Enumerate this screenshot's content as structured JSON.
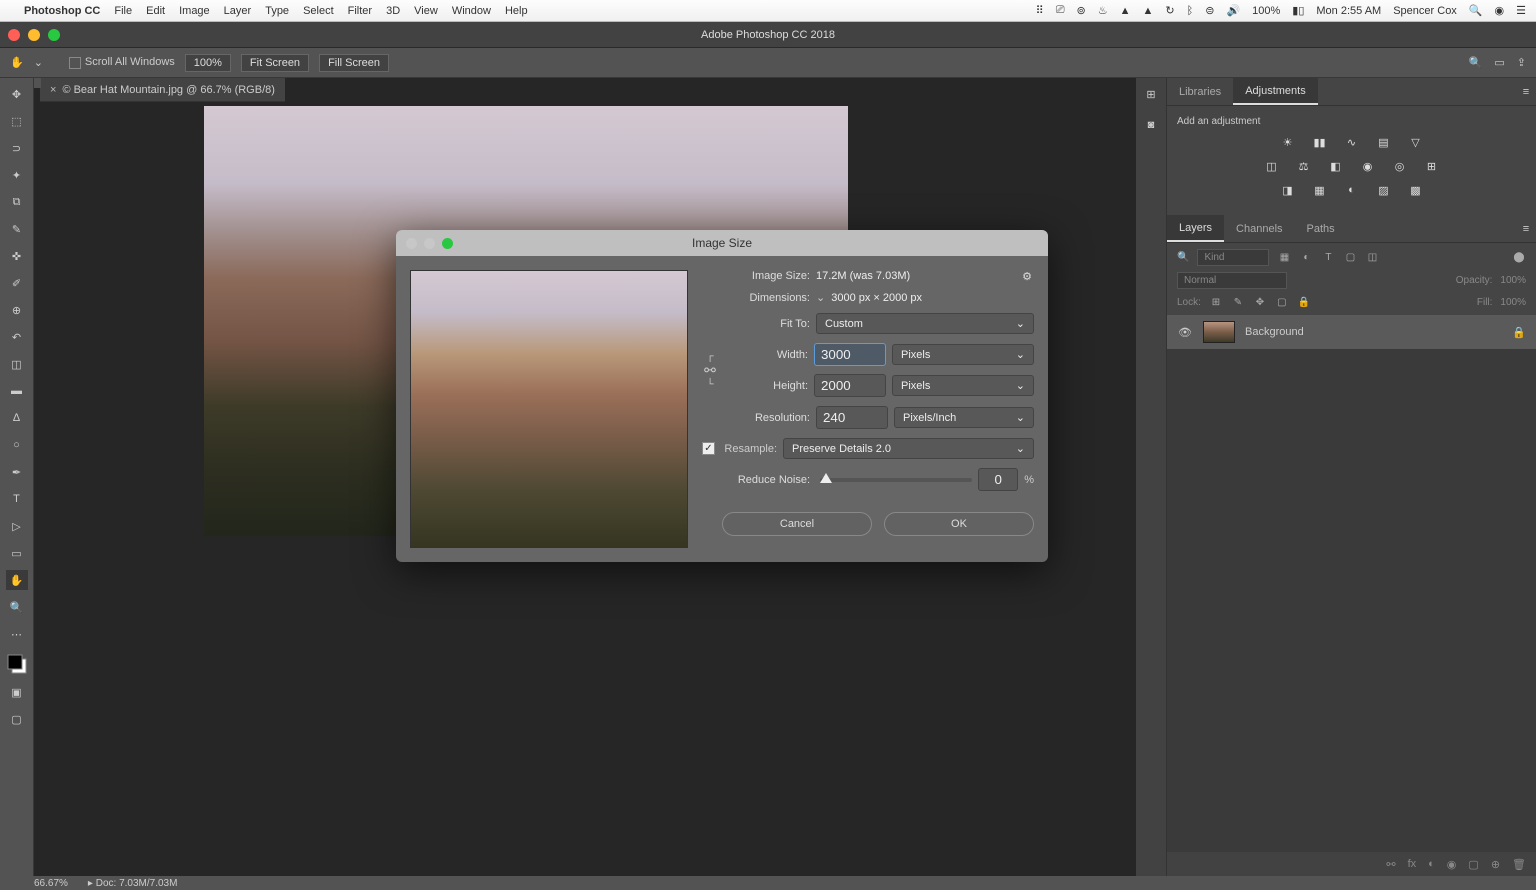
{
  "menubar": {
    "apple": "",
    "app": "Photoshop CC",
    "items": [
      "File",
      "Edit",
      "Image",
      "Layer",
      "Type",
      "Select",
      "Filter",
      "3D",
      "View",
      "Window",
      "Help"
    ],
    "battery": "100%",
    "clock": "Mon 2:55 AM",
    "user": "Spencer Cox"
  },
  "window": {
    "title": "Adobe Photoshop CC 2018"
  },
  "options": {
    "scroll_all": "Scroll All Windows",
    "zoom": "100%",
    "fit": "Fit Screen",
    "fill": "Fill Screen"
  },
  "document": {
    "tab": "© Bear Hat Mountain.jpg @ 66.7% (RGB/8)",
    "close": "×"
  },
  "panels": {
    "libraries": "Libraries",
    "adjustments": "Adjustments",
    "add_adj": "Add an adjustment",
    "layers": "Layers",
    "channels": "Channels",
    "paths": "Paths",
    "kind": "Kind",
    "blend": "Normal",
    "opacity_label": "Opacity:",
    "opacity_val": "100%",
    "lock_label": "Lock:",
    "fill_label": "Fill:",
    "fill_val": "100%",
    "layer_name": "Background"
  },
  "dialog": {
    "title": "Image Size",
    "image_size_label": "Image Size:",
    "image_size_val": "17.2M (was 7.03M)",
    "dimensions_label": "Dimensions:",
    "dimensions_val": "3000 px × 2000 px",
    "fitto_label": "Fit To:",
    "fitto_val": "Custom",
    "width_label": "Width:",
    "width_val": "3000",
    "height_label": "Height:",
    "height_val": "2000",
    "unit_px": "Pixels",
    "res_label": "Resolution:",
    "res_val": "240",
    "res_unit": "Pixels/Inch",
    "resample_label": "Resample:",
    "resample_val": "Preserve Details 2.0",
    "noise_label": "Reduce Noise:",
    "noise_val": "0",
    "pct": "%",
    "cancel": "Cancel",
    "ok": "OK",
    "check": "✓"
  },
  "status": {
    "zoom": "66.67%",
    "doc": "Doc: 7.03M/7.03M"
  }
}
